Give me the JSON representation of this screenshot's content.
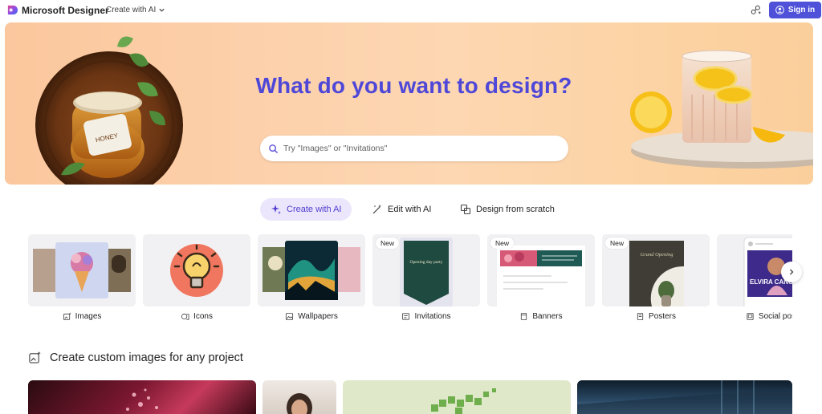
{
  "app": {
    "brand": "Microsoft Designer",
    "create_menu_label": "Create with AI",
    "signin_label": "Sign in"
  },
  "hero": {
    "title": "What do you want to design?",
    "search_placeholder": "Try \"Images\" or \"Invitations\""
  },
  "tabs": [
    {
      "label": "Create with AI",
      "active": true,
      "icon": "sparkle-icon"
    },
    {
      "label": "Edit with AI",
      "active": false,
      "icon": "magic-wand-icon"
    },
    {
      "label": "Design from scratch",
      "active": false,
      "icon": "shapes-icon"
    }
  ],
  "categories": [
    {
      "label": "Images",
      "icon": "image-sparkle-icon",
      "badge": ""
    },
    {
      "label": "Icons",
      "icon": "icons-icon",
      "badge": ""
    },
    {
      "label": "Wallpapers",
      "icon": "wallpaper-icon",
      "badge": ""
    },
    {
      "label": "Invitations",
      "icon": "invitation-icon",
      "badge": "New"
    },
    {
      "label": "Banners",
      "icon": "banner-icon",
      "badge": "New"
    },
    {
      "label": "Posters",
      "icon": "poster-icon",
      "badge": "New"
    },
    {
      "label": "Social pos",
      "icon": "social-post-icon",
      "badge": ""
    }
  ],
  "thumbnail_text": {
    "jar_label": "HONEY",
    "invitation_title": "Opening day party",
    "poster_title": "Grand Opening",
    "social_name": "ELVIRA CANO"
  },
  "section": {
    "title": "Create custom images for any project"
  },
  "colors": {
    "accent": "#4f52d8",
    "hero_title": "#4e47d8",
    "active_tab_bg": "#ebe6fb"
  }
}
